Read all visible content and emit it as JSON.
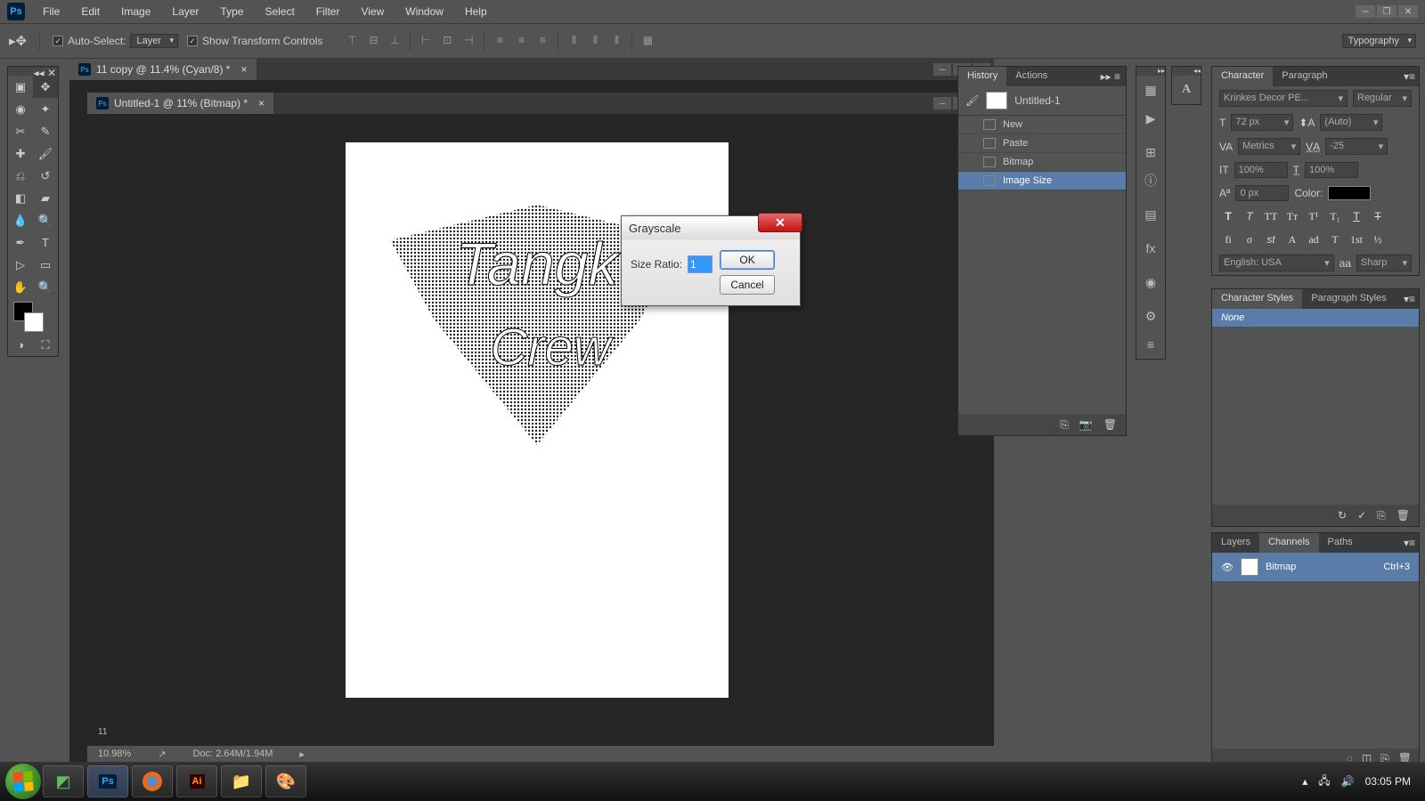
{
  "app": {
    "logo": "Ps"
  },
  "menu": [
    "File",
    "Edit",
    "Image",
    "Layer",
    "Type",
    "Select",
    "Filter",
    "View",
    "Window",
    "Help"
  ],
  "options": {
    "auto_select": "Auto-Select:",
    "layer_dd": "Layer",
    "show_transform": "Show Transform Controls",
    "typography": "Typography"
  },
  "documents": {
    "tab1": "11 copy @ 11.4% (Cyan/8) *",
    "tab2": "Untitled-1 @ 11% (Bitmap) *"
  },
  "status": {
    "zoom": "10.98%",
    "doc": "Doc: 2.64M/1.94M",
    "eleven": "11"
  },
  "dialog": {
    "title": "Grayscale",
    "label": "Size Ratio:",
    "value": "1",
    "ok": "OK",
    "cancel": "Cancel"
  },
  "history": {
    "tab1": "History",
    "tab2": "Actions",
    "snapshot": "Untitled-1",
    "items": [
      "New",
      "Paste",
      "Bitmap",
      "Image Size"
    ]
  },
  "character": {
    "tab1": "Character",
    "tab2": "Paragraph",
    "font": "Krinkes Decor PE...",
    "style": "Regular",
    "size": "72 px",
    "leading": "(Auto)",
    "kerning": "Metrics",
    "tracking": "-25",
    "vscale": "100%",
    "hscale": "100%",
    "baseline": "0 px",
    "color_label": "Color:",
    "lang": "English: USA",
    "aa": "Sharp"
  },
  "char_styles": {
    "tab1": "Character Styles",
    "tab2": "Paragraph Styles",
    "none": "None"
  },
  "layers": {
    "tab1": "Layers",
    "tab2": "Channels",
    "tab3": "Paths",
    "item": "Bitmap",
    "shortcut": "Ctrl+3"
  },
  "taskbar": {
    "time": "03:05 PM"
  },
  "canvas_text": {
    "a": "Tangk",
    "b": "Crew"
  }
}
